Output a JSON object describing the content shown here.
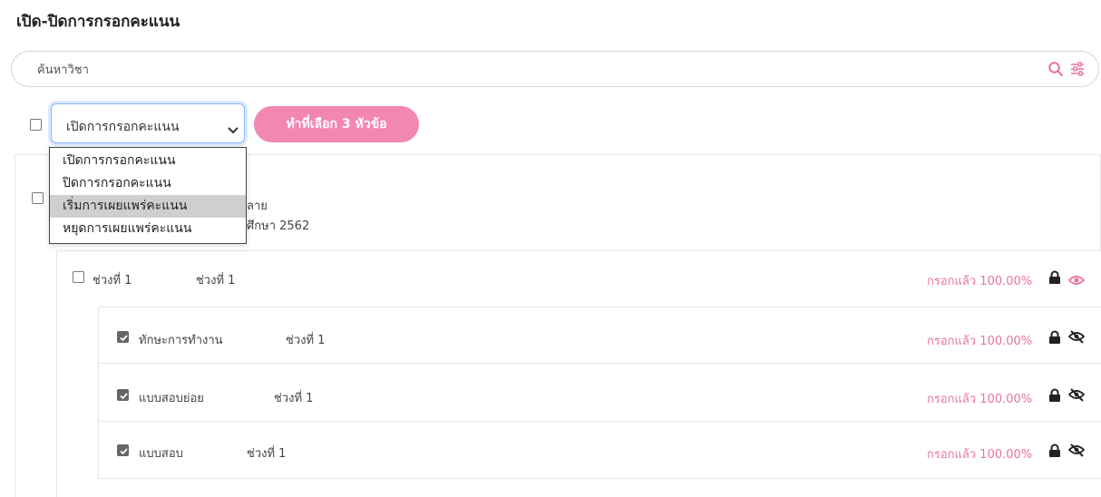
{
  "page": {
    "title": "เปิด-ปิดการกรอกคะแนน"
  },
  "search": {
    "placeholder": "ค้นหาวิชา"
  },
  "toolbar": {
    "select_value": "เปิดการกรอกคะแนน",
    "action_label": "ทำที่เลือก 3 หัวข้อ",
    "options": [
      "เปิดการกรอกคะแนน",
      "ปิดการกรอกคะแนน",
      "เริ่มการเผยแพร่คะแนน",
      "หยุดการเผยแพร่คะแนน"
    ],
    "highlighted_option": "เริ่มการเผยแพร่คะแนน"
  },
  "course": {
    "line1_tail": "ลาย",
    "line2_tail": "ศึกษา 2562"
  },
  "period": {
    "label": "ช่วงที่ 1",
    "value": "ช่วงที่ 1",
    "status": "กรอกแล้ว 100.00%"
  },
  "items": [
    {
      "name": "ทักษะการทำงาน",
      "period": "ช่วงที่ 1",
      "status": "กรอกแล้ว 100.00%",
      "checked": true
    },
    {
      "name": "แบบสอบย่อย",
      "period": "ช่วงที่ 1",
      "status": "กรอกแล้ว 100.00%",
      "checked": true
    },
    {
      "name": "แบบสอบ",
      "period": "ช่วงที่ 1",
      "status": "กรอกแล้ว 100.00%",
      "checked": true
    }
  ],
  "colors": {
    "accent": "#f287b2",
    "status_text": "#e8739f",
    "highlight": "#cfcfcf"
  },
  "icons": {
    "search": "search-icon",
    "filter": "filter-icon",
    "lock": "lock-icon",
    "visible": "eye-icon",
    "hidden": "eye-off-icon"
  }
}
